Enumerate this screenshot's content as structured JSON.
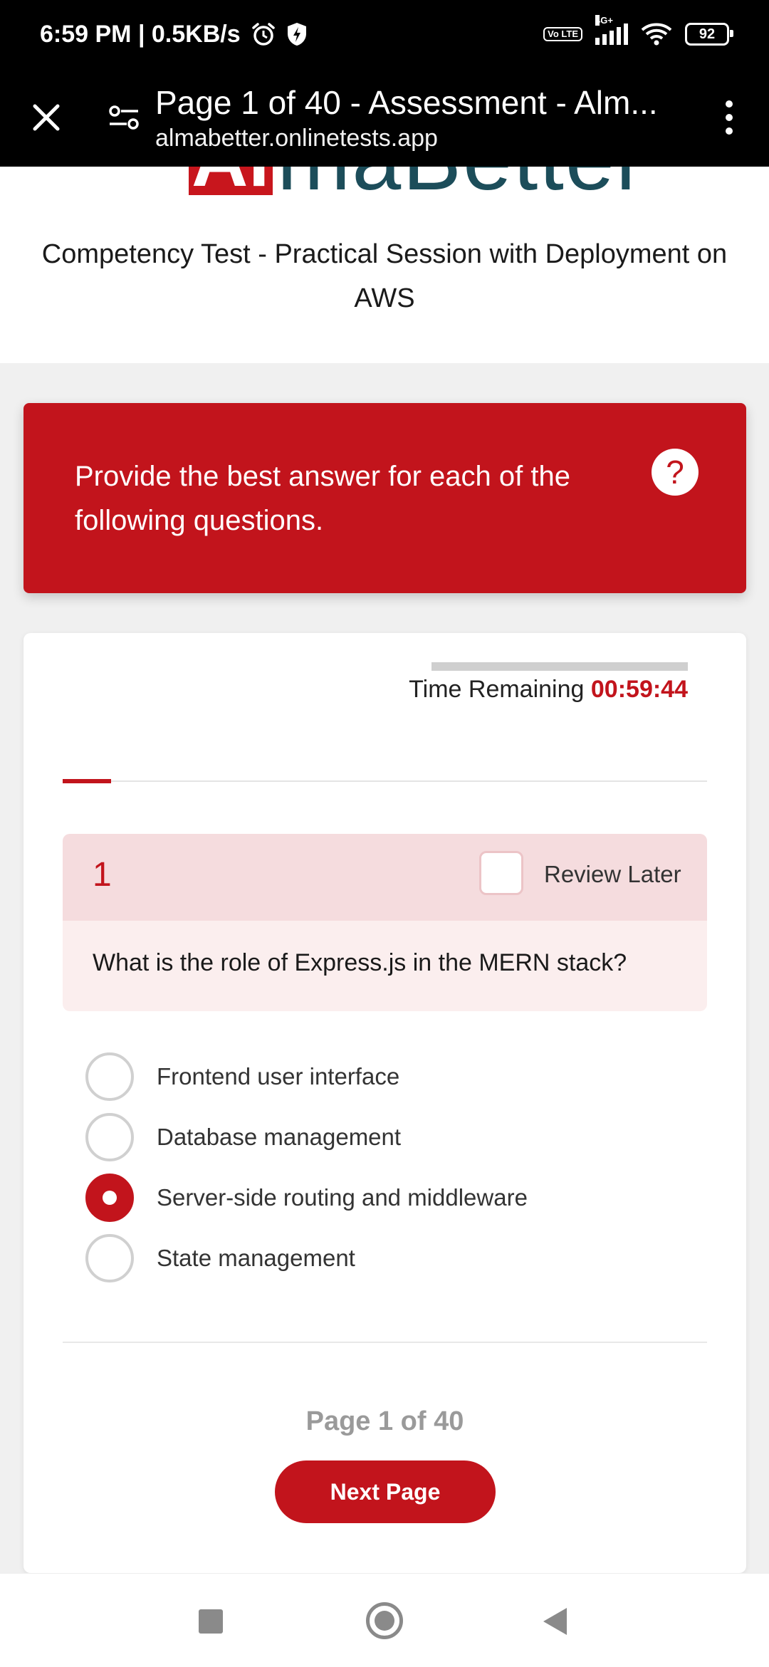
{
  "status_bar": {
    "time_speed": "6:59 PM | 0.5KB/s",
    "volte": "Vo LTE",
    "network": "4G+",
    "battery": "92"
  },
  "browser": {
    "title": "Page 1 of 40 - Assessment - Alm...",
    "url": "almabetter.onlinetests.app"
  },
  "header": {
    "logo_first": "Al",
    "logo_rest": "maBetter",
    "test_title": "Competency Test - Practical Session with Deployment on AWS"
  },
  "banner": {
    "text": "Provide the best answer for each of the following questions.",
    "help_symbol": "?"
  },
  "timer": {
    "label": "Time Remaining",
    "value": "00:59:44"
  },
  "progress": {
    "fraction": 0.075
  },
  "question": {
    "number": "1",
    "review_label": "Review Later",
    "text": "What is the role of Express.js in the MERN stack?",
    "options": [
      {
        "label": "Frontend user interface",
        "selected": false
      },
      {
        "label": "Database management",
        "selected": false
      },
      {
        "label": "Server-side routing and middleware",
        "selected": true
      },
      {
        "label": "State management",
        "selected": false
      }
    ]
  },
  "pagination": {
    "indicator": "Page 1 of 40",
    "next_label": "Next Page"
  },
  "colors": {
    "accent": "#c2141c",
    "logo_teal": "#1c4d5a"
  }
}
